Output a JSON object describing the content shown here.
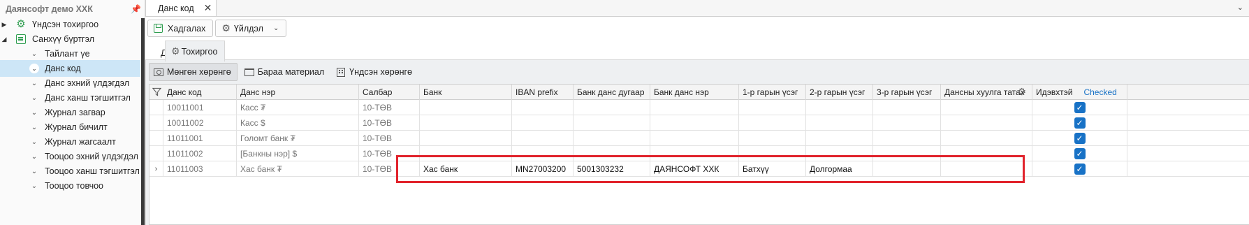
{
  "sidebar": {
    "title": "Даянсофт демо ХХК",
    "items": [
      {
        "label": "Үндсэн тохиргоо",
        "expander": "▶",
        "icon": "gear-icon"
      },
      {
        "label": "Санхүү бүртгэл",
        "expander": "◢",
        "icon": "ledger-icon"
      },
      {
        "label": "Тайлант үе",
        "icon": "chevron-down-icon"
      },
      {
        "label": "Данс код",
        "icon": "chevron-down-icon",
        "selected": true
      },
      {
        "label": "Данс эхний үлдэгдэл",
        "icon": "chevron-down-icon"
      },
      {
        "label": "Данс ханш тэгшитгэл",
        "icon": "chevron-down-icon"
      },
      {
        "label": "Журнал загвар",
        "icon": "chevron-down-icon"
      },
      {
        "label": "Журнал бичилт",
        "icon": "chevron-down-icon"
      },
      {
        "label": "Журнал жагсаалт",
        "icon": "chevron-down-icon"
      },
      {
        "label": "Тооцоо эхний үлдэгдэл",
        "icon": "chevron-down-icon"
      },
      {
        "label": "Тооцоо ханш тэгшитгэл",
        "icon": "chevron-down-icon"
      },
      {
        "label": "Тооцоо товчоо",
        "icon": "chevron-down-icon"
      }
    ]
  },
  "doc_tab": {
    "label": "Данс код",
    "close": "✕"
  },
  "toolbar": {
    "save_label": "Хадгалах",
    "actions_label": "Үйлдэл"
  },
  "section_tabs": {
    "account": "Данс",
    "settings": "Тохиргоо"
  },
  "inner_tabs": {
    "cash": "Мөнгөн хөрөнгө",
    "inventory": "Бараа материал",
    "fixed": "Үндсэн хөрөнгө"
  },
  "grid": {
    "columns": [
      "Данс код",
      "Данс нэр",
      "Салбар",
      "Банк",
      "IBAN prefix",
      "Банк данс дугаар",
      "Банк данс нэр",
      "1-р гарын үсэг",
      "2-р гарын үсэг",
      "3-р гарын үсэг",
      "Дансны хуулга татах",
      "Идэвхтэй",
      "Checked"
    ],
    "rows": [
      {
        "code": "10011001",
        "name": "Касс ₮",
        "branch": "10-ТӨВ",
        "bank": "",
        "iban": "",
        "bank_acc": "",
        "bank_acc_name": "",
        "sig1": "",
        "sig2": "",
        "sig3": "",
        "active": true
      },
      {
        "code": "10011002",
        "name": "Касс $",
        "branch": "10-ТӨВ",
        "bank": "",
        "iban": "",
        "bank_acc": "",
        "bank_acc_name": "",
        "sig1": "",
        "sig2": "",
        "sig3": "",
        "active": true
      },
      {
        "code": "11011001",
        "name": "Голомт банк ₮",
        "branch": "10-ТӨВ",
        "bank": "",
        "iban": "",
        "bank_acc": "",
        "bank_acc_name": "",
        "sig1": "",
        "sig2": "",
        "sig3": "",
        "active": true
      },
      {
        "code": "11011002",
        "name": "[Банкны нэр] $",
        "branch": "10-ТӨВ",
        "bank": "",
        "iban": "",
        "bank_acc": "",
        "bank_acc_name": "",
        "sig1": "",
        "sig2": "",
        "sig3": "",
        "active": true
      },
      {
        "code": "11011003",
        "name": "Хас банк ₮",
        "branch": "10-ТӨВ",
        "bank": "Хас банк",
        "iban": "MN27003200",
        "bank_acc": "5001303232",
        "bank_acc_name": "ДАЯНСОФТ ХХК",
        "sig1": "Батхүү",
        "sig2": "Долгормаа",
        "sig3": "",
        "active": true,
        "current": true
      }
    ]
  },
  "colors": {
    "accent": "#1872c6",
    "highlight": "#e1232c",
    "brand_green": "#2e9d4f",
    "selection": "#cde6f7"
  }
}
